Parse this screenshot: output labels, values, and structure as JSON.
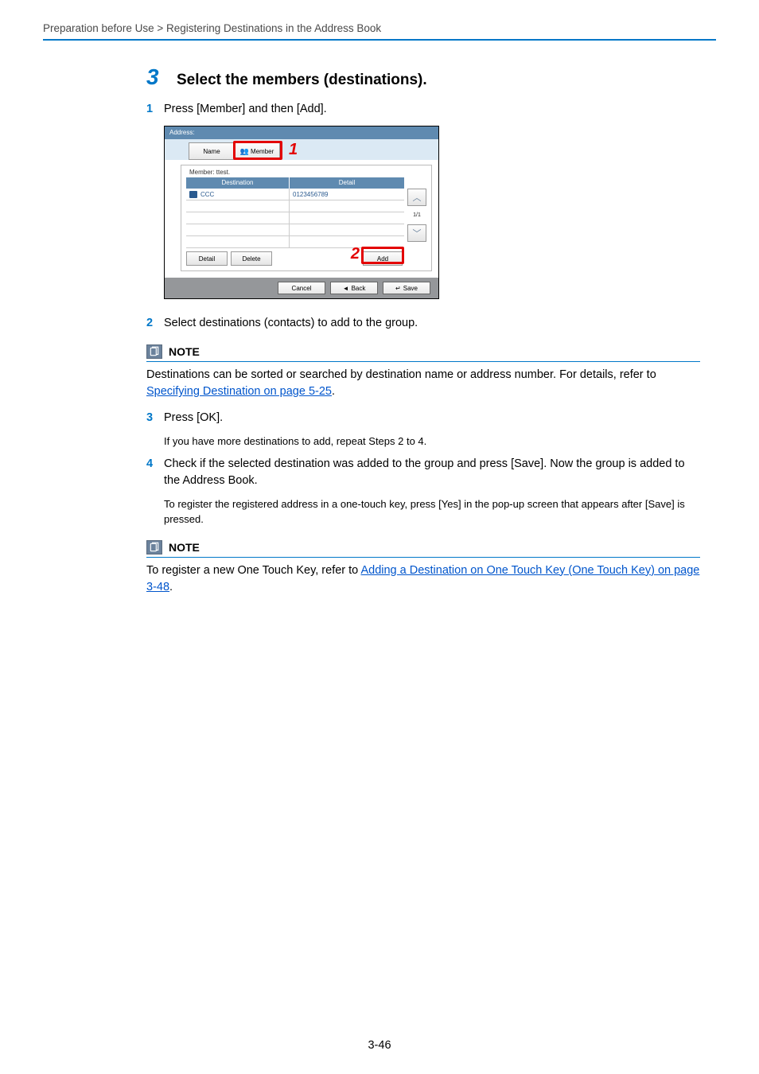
{
  "breadcrumb": "Preparation before Use > Registering Destinations in the Address Book",
  "step": {
    "number": "3",
    "title": "Select the members (destinations).",
    "items": {
      "i1": {
        "num": "1",
        "text": "Press [Member] and then [Add]."
      },
      "i2": {
        "num": "2",
        "text": "Select destinations (contacts) to add to the group."
      },
      "i3": {
        "num": "3",
        "text": "Press [OK].",
        "extra": "If you have more destinations to add, repeat Steps 2 to 4."
      },
      "i4": {
        "num": "4",
        "text": "Check if the selected destination was added to the group and press [Save]. Now the group is added to the Address Book.",
        "extra": "To register the registered address in a one-touch key, press [Yes] in the pop-up screen that appears after [Save] is pressed."
      }
    }
  },
  "note1": {
    "label": "NOTE",
    "body_pre": "Destinations can be sorted or searched by destination name or address number. For details, refer to ",
    "link": "Specifying Destination on page 5-25",
    "body_post": "."
  },
  "note2": {
    "label": "NOTE",
    "body_pre": "To register a new One Touch Key, refer to ",
    "link": "Adding a Destination on One Touch Key (One Touch Key) on page 3-48",
    "body_post": "."
  },
  "shot": {
    "title": "Address:",
    "tab_name": "Name",
    "tab_member": "Member",
    "subheader": "Member: ttest.",
    "col_dest": "Destination",
    "col_detail": "Detail",
    "row_dest": "CCC",
    "row_detail": "0123456789",
    "page": "1/1",
    "btn_detail": "Detail",
    "btn_delete": "Delete",
    "btn_add": "Add",
    "btn_cancel": "Cancel",
    "btn_back": "Back",
    "btn_save": "Save",
    "callout1": "1",
    "callout2": "2"
  },
  "page_number": "3-46"
}
